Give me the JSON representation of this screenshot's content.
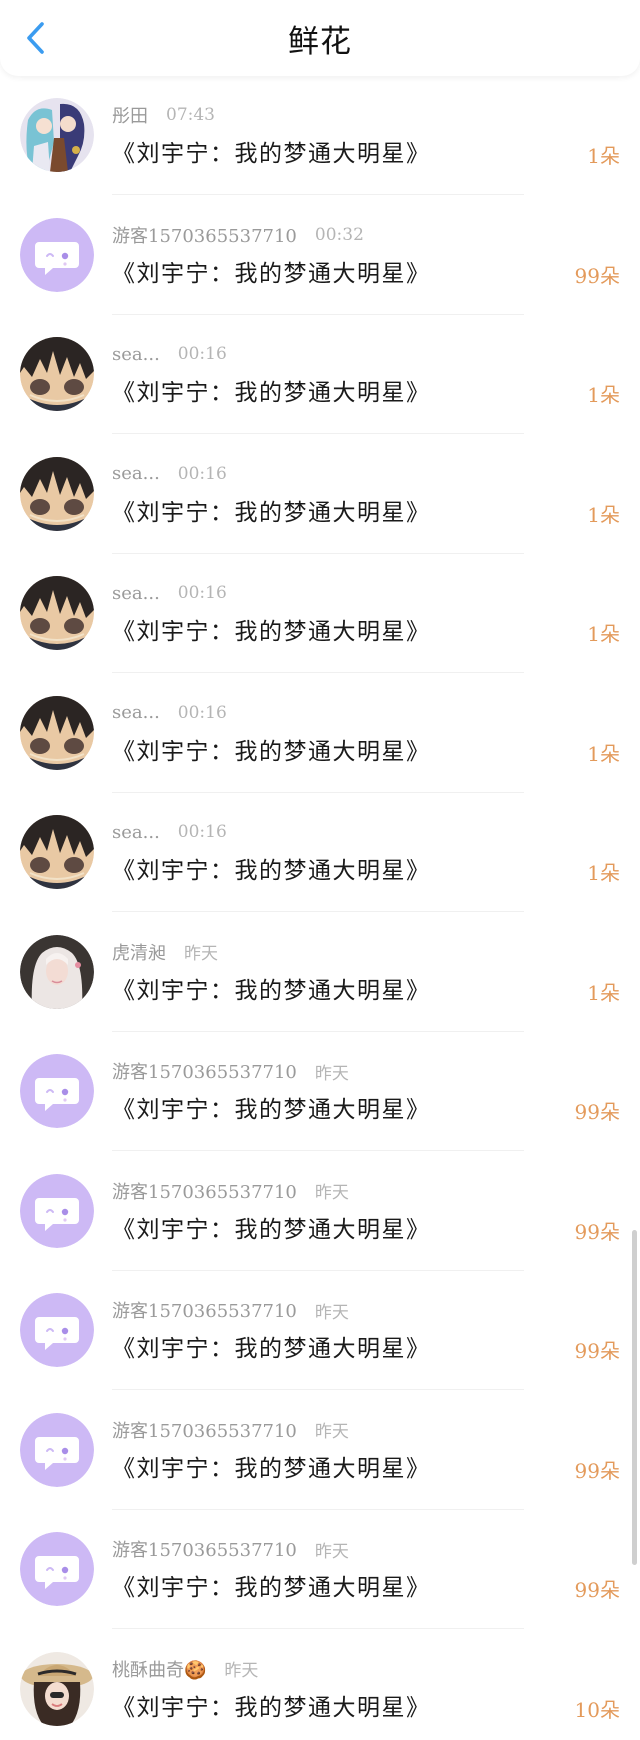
{
  "header": {
    "title": "鲜花",
    "back_icon": "chevron-left-icon",
    "accent": "#3b9cf0"
  },
  "colors": {
    "count": "#e39a5b",
    "guest_avatar_bg": "#cdb9f5"
  },
  "list": {
    "items": [
      {
        "name": "彤田",
        "time": "07:43",
        "title": "《刘宇宁：我的梦通大明星》",
        "count": "1朵",
        "avatar": "anime-couple"
      },
      {
        "name": "游客1570365537710",
        "time": "00:32",
        "title": "《刘宇宁：我的梦通大明星》",
        "count": "99朵",
        "avatar": "guest"
      },
      {
        "name": "sea...",
        "time": "00:16",
        "title": "《刘宇宁：我的梦通大明星》",
        "count": "1朵",
        "avatar": "dark-hair"
      },
      {
        "name": "sea...",
        "time": "00:16",
        "title": "《刘宇宁：我的梦通大明星》",
        "count": "1朵",
        "avatar": "dark-hair"
      },
      {
        "name": "sea...",
        "time": "00:16",
        "title": "《刘宇宁：我的梦通大明星》",
        "count": "1朵",
        "avatar": "dark-hair"
      },
      {
        "name": "sea...",
        "time": "00:16",
        "title": "《刘宇宁：我的梦通大明星》",
        "count": "1朵",
        "avatar": "dark-hair"
      },
      {
        "name": "sea...",
        "time": "00:16",
        "title": "《刘宇宁：我的梦通大明星》",
        "count": "1朵",
        "avatar": "dark-hair"
      },
      {
        "name": "虎清昶",
        "time": "昨天",
        "title": "《刘宇宁：我的梦通大明星》",
        "count": "1朵",
        "avatar": "white-hair-girl"
      },
      {
        "name": "游客1570365537710",
        "time": "昨天",
        "title": "《刘宇宁：我的梦通大明星》",
        "count": "99朵",
        "avatar": "guest"
      },
      {
        "name": "游客1570365537710",
        "time": "昨天",
        "title": "《刘宇宁：我的梦通大明星》",
        "count": "99朵",
        "avatar": "guest"
      },
      {
        "name": "游客1570365537710",
        "time": "昨天",
        "title": "《刘宇宁：我的梦通大明星》",
        "count": "99朵",
        "avatar": "guest"
      },
      {
        "name": "游客1570365537710",
        "time": "昨天",
        "title": "《刘宇宁：我的梦通大明星》",
        "count": "99朵",
        "avatar": "guest"
      },
      {
        "name": "游客1570365537710",
        "time": "昨天",
        "title": "《刘宇宁：我的梦通大明星》",
        "count": "99朵",
        "avatar": "guest"
      },
      {
        "name": "桃酥曲奇🍪",
        "time": "昨天",
        "title": "《刘宇宁：我的梦通大明星》",
        "count": "10朵",
        "avatar": "straw-hat-girl"
      }
    ]
  }
}
